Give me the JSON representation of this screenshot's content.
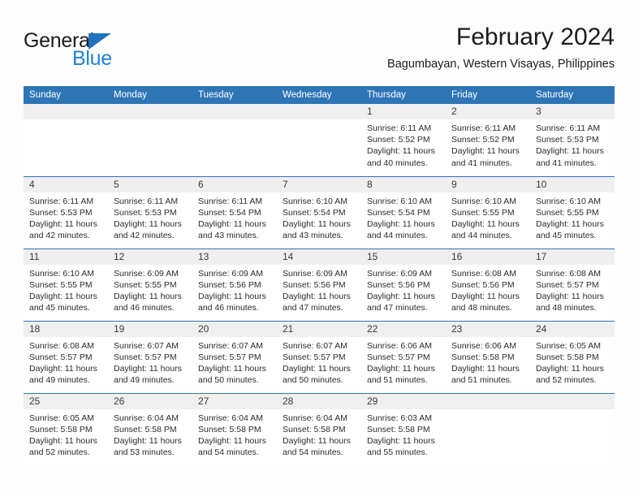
{
  "brand": {
    "name_top": "General",
    "name_bottom": "Blue",
    "triangle_icon": "blue-triangle-logo-mark",
    "color_dark": "#1b1b1b",
    "color_blue": "#1f82d4"
  },
  "header": {
    "month_title": "February 2024",
    "location": "Bagumbayan, Western Visayas, Philippines"
  },
  "theme": {
    "header_blue": "#2e75b6",
    "daynum_band": "#efefef",
    "page_bg": "#fdfdfd",
    "text": "#2b2b2b"
  },
  "weekday_headers": [
    "Sunday",
    "Monday",
    "Tuesday",
    "Wednesday",
    "Thursday",
    "Friday",
    "Saturday"
  ],
  "weeks": [
    [
      {
        "day": "",
        "sunrise": "",
        "sunset": "",
        "daylight_line1": "",
        "daylight_line2": ""
      },
      {
        "day": "",
        "sunrise": "",
        "sunset": "",
        "daylight_line1": "",
        "daylight_line2": ""
      },
      {
        "day": "",
        "sunrise": "",
        "sunset": "",
        "daylight_line1": "",
        "daylight_line2": ""
      },
      {
        "day": "",
        "sunrise": "",
        "sunset": "",
        "daylight_line1": "",
        "daylight_line2": ""
      },
      {
        "day": "1",
        "sunrise": "Sunrise: 6:11 AM",
        "sunset": "Sunset: 5:52 PM",
        "daylight_line1": "Daylight: 11 hours",
        "daylight_line2": "and 40 minutes."
      },
      {
        "day": "2",
        "sunrise": "Sunrise: 6:11 AM",
        "sunset": "Sunset: 5:52 PM",
        "daylight_line1": "Daylight: 11 hours",
        "daylight_line2": "and 41 minutes."
      },
      {
        "day": "3",
        "sunrise": "Sunrise: 6:11 AM",
        "sunset": "Sunset: 5:53 PM",
        "daylight_line1": "Daylight: 11 hours",
        "daylight_line2": "and 41 minutes."
      }
    ],
    [
      {
        "day": "4",
        "sunrise": "Sunrise: 6:11 AM",
        "sunset": "Sunset: 5:53 PM",
        "daylight_line1": "Daylight: 11 hours",
        "daylight_line2": "and 42 minutes."
      },
      {
        "day": "5",
        "sunrise": "Sunrise: 6:11 AM",
        "sunset": "Sunset: 5:53 PM",
        "daylight_line1": "Daylight: 11 hours",
        "daylight_line2": "and 42 minutes."
      },
      {
        "day": "6",
        "sunrise": "Sunrise: 6:11 AM",
        "sunset": "Sunset: 5:54 PM",
        "daylight_line1": "Daylight: 11 hours",
        "daylight_line2": "and 43 minutes."
      },
      {
        "day": "7",
        "sunrise": "Sunrise: 6:10 AM",
        "sunset": "Sunset: 5:54 PM",
        "daylight_line1": "Daylight: 11 hours",
        "daylight_line2": "and 43 minutes."
      },
      {
        "day": "8",
        "sunrise": "Sunrise: 6:10 AM",
        "sunset": "Sunset: 5:54 PM",
        "daylight_line1": "Daylight: 11 hours",
        "daylight_line2": "and 44 minutes."
      },
      {
        "day": "9",
        "sunrise": "Sunrise: 6:10 AM",
        "sunset": "Sunset: 5:55 PM",
        "daylight_line1": "Daylight: 11 hours",
        "daylight_line2": "and 44 minutes."
      },
      {
        "day": "10",
        "sunrise": "Sunrise: 6:10 AM",
        "sunset": "Sunset: 5:55 PM",
        "daylight_line1": "Daylight: 11 hours",
        "daylight_line2": "and 45 minutes."
      }
    ],
    [
      {
        "day": "11",
        "sunrise": "Sunrise: 6:10 AM",
        "sunset": "Sunset: 5:55 PM",
        "daylight_line1": "Daylight: 11 hours",
        "daylight_line2": "and 45 minutes."
      },
      {
        "day": "12",
        "sunrise": "Sunrise: 6:09 AM",
        "sunset": "Sunset: 5:55 PM",
        "daylight_line1": "Daylight: 11 hours",
        "daylight_line2": "and 46 minutes."
      },
      {
        "day": "13",
        "sunrise": "Sunrise: 6:09 AM",
        "sunset": "Sunset: 5:56 PM",
        "daylight_line1": "Daylight: 11 hours",
        "daylight_line2": "and 46 minutes."
      },
      {
        "day": "14",
        "sunrise": "Sunrise: 6:09 AM",
        "sunset": "Sunset: 5:56 PM",
        "daylight_line1": "Daylight: 11 hours",
        "daylight_line2": "and 47 minutes."
      },
      {
        "day": "15",
        "sunrise": "Sunrise: 6:09 AM",
        "sunset": "Sunset: 5:56 PM",
        "daylight_line1": "Daylight: 11 hours",
        "daylight_line2": "and 47 minutes."
      },
      {
        "day": "16",
        "sunrise": "Sunrise: 6:08 AM",
        "sunset": "Sunset: 5:56 PM",
        "daylight_line1": "Daylight: 11 hours",
        "daylight_line2": "and 48 minutes."
      },
      {
        "day": "17",
        "sunrise": "Sunrise: 6:08 AM",
        "sunset": "Sunset: 5:57 PM",
        "daylight_line1": "Daylight: 11 hours",
        "daylight_line2": "and 48 minutes."
      }
    ],
    [
      {
        "day": "18",
        "sunrise": "Sunrise: 6:08 AM",
        "sunset": "Sunset: 5:57 PM",
        "daylight_line1": "Daylight: 11 hours",
        "daylight_line2": "and 49 minutes."
      },
      {
        "day": "19",
        "sunrise": "Sunrise: 6:07 AM",
        "sunset": "Sunset: 5:57 PM",
        "daylight_line1": "Daylight: 11 hours",
        "daylight_line2": "and 49 minutes."
      },
      {
        "day": "20",
        "sunrise": "Sunrise: 6:07 AM",
        "sunset": "Sunset: 5:57 PM",
        "daylight_line1": "Daylight: 11 hours",
        "daylight_line2": "and 50 minutes."
      },
      {
        "day": "21",
        "sunrise": "Sunrise: 6:07 AM",
        "sunset": "Sunset: 5:57 PM",
        "daylight_line1": "Daylight: 11 hours",
        "daylight_line2": "and 50 minutes."
      },
      {
        "day": "22",
        "sunrise": "Sunrise: 6:06 AM",
        "sunset": "Sunset: 5:57 PM",
        "daylight_line1": "Daylight: 11 hours",
        "daylight_line2": "and 51 minutes."
      },
      {
        "day": "23",
        "sunrise": "Sunrise: 6:06 AM",
        "sunset": "Sunset: 5:58 PM",
        "daylight_line1": "Daylight: 11 hours",
        "daylight_line2": "and 51 minutes."
      },
      {
        "day": "24",
        "sunrise": "Sunrise: 6:05 AM",
        "sunset": "Sunset: 5:58 PM",
        "daylight_line1": "Daylight: 11 hours",
        "daylight_line2": "and 52 minutes."
      }
    ],
    [
      {
        "day": "25",
        "sunrise": "Sunrise: 6:05 AM",
        "sunset": "Sunset: 5:58 PM",
        "daylight_line1": "Daylight: 11 hours",
        "daylight_line2": "and 52 minutes."
      },
      {
        "day": "26",
        "sunrise": "Sunrise: 6:04 AM",
        "sunset": "Sunset: 5:58 PM",
        "daylight_line1": "Daylight: 11 hours",
        "daylight_line2": "and 53 minutes."
      },
      {
        "day": "27",
        "sunrise": "Sunrise: 6:04 AM",
        "sunset": "Sunset: 5:58 PM",
        "daylight_line1": "Daylight: 11 hours",
        "daylight_line2": "and 54 minutes."
      },
      {
        "day": "28",
        "sunrise": "Sunrise: 6:04 AM",
        "sunset": "Sunset: 5:58 PM",
        "daylight_line1": "Daylight: 11 hours",
        "daylight_line2": "and 54 minutes."
      },
      {
        "day": "29",
        "sunrise": "Sunrise: 6:03 AM",
        "sunset": "Sunset: 5:58 PM",
        "daylight_line1": "Daylight: 11 hours",
        "daylight_line2": "and 55 minutes."
      },
      {
        "day": "",
        "sunrise": "",
        "sunset": "",
        "daylight_line1": "",
        "daylight_line2": ""
      },
      {
        "day": "",
        "sunrise": "",
        "sunset": "",
        "daylight_line1": "",
        "daylight_line2": ""
      }
    ]
  ]
}
